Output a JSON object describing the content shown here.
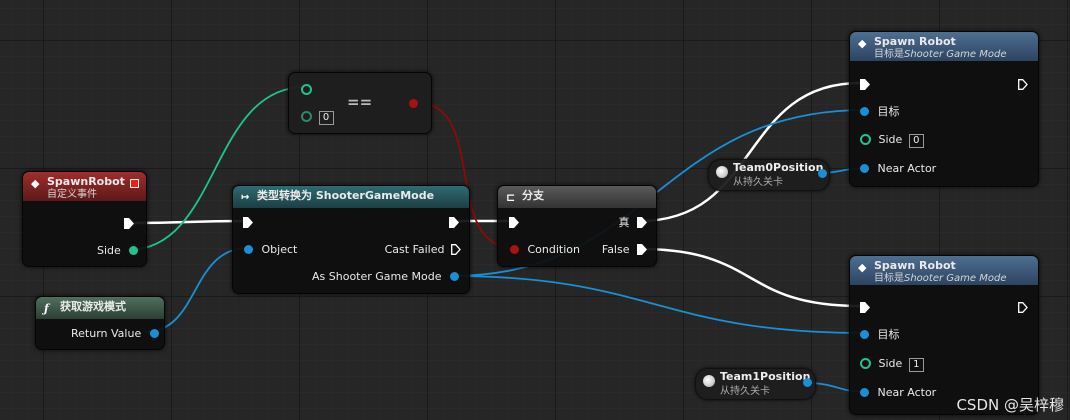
{
  "event_node": {
    "title": "SpawnRobot",
    "subtitle": "自定义事件",
    "pin_side": "Side"
  },
  "cast_node": {
    "title": "类型转换为 ShooterGameMode",
    "pin_object": "Object",
    "pin_cast_failed": "Cast Failed",
    "pin_as": "As Shooter Game Mode"
  },
  "func_node": {
    "title": "获取游戏模式",
    "pin_return": "Return Value",
    "icon": "function-icon"
  },
  "equal_node": {
    "operator": "==",
    "value_b": "0"
  },
  "branch_node": {
    "title": "分支",
    "pin_condition": "Condition",
    "pin_true": "真",
    "pin_false": "False"
  },
  "spawn_nodes": [
    {
      "title": "Spawn Robot",
      "subtitle_prefix": "目标是",
      "subtitle_target": "Shooter Game Mode",
      "pin_target": "目标",
      "pin_side": "Side",
      "side_value": "0",
      "pin_near_actor": "Near Actor"
    },
    {
      "title": "Spawn Robot",
      "subtitle_prefix": "目标是",
      "subtitle_target": "Shooter Game Mode",
      "pin_target": "目标",
      "pin_side": "Side",
      "side_value": "1",
      "pin_near_actor": "Near Actor"
    }
  ],
  "var_nodes": [
    {
      "name": "Team0Position",
      "subtitle": "从持久关卡"
    },
    {
      "name": "Team1Position",
      "subtitle": "从持久关卡"
    }
  ],
  "watermark": "CSDN @吴梓穆",
  "colors": {
    "background": "#262626",
    "exec_wire": "#ffffff",
    "object_wire": "#1a8fd6",
    "int_wire": "#1fc48c",
    "bool_wire": "#8b0b0b",
    "event_header": "#a12d2d",
    "cast_header": "#2e6b72",
    "spawn_header": "#4d6f92"
  }
}
